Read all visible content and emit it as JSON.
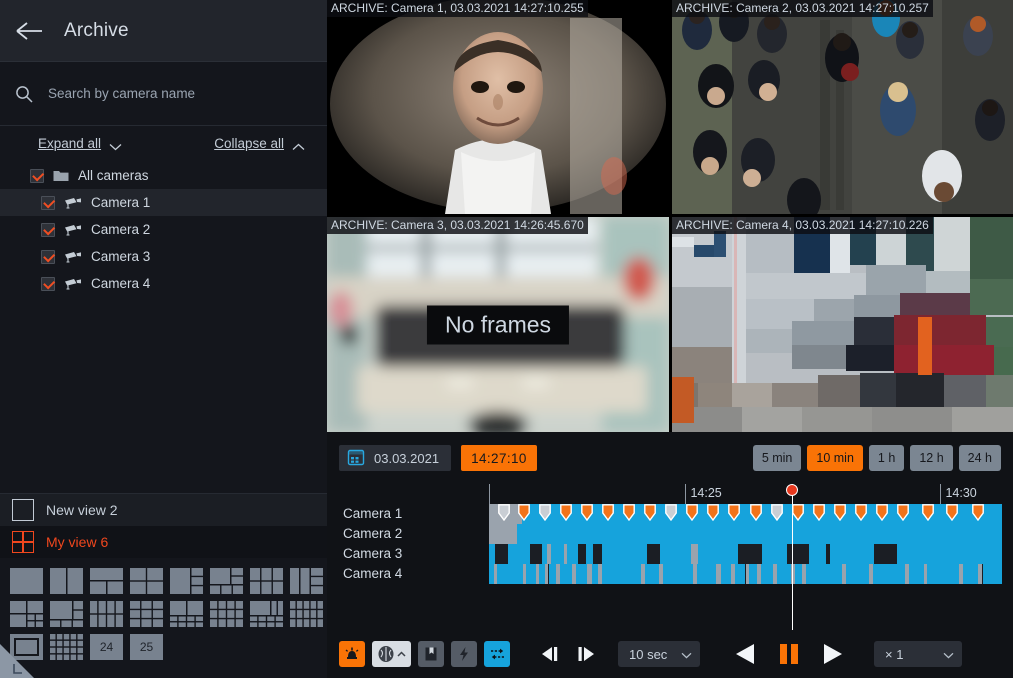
{
  "sidebar": {
    "back_icon": "back-arrow-icon",
    "title": "Archive",
    "search": {
      "icon": "search-icon",
      "placeholder": "Search by camera name",
      "value": ""
    },
    "expand_all": "Expand all",
    "collapse_all": "Collapse all",
    "tree": [
      {
        "label": "All cameras",
        "icon": "folder-icon",
        "checked": true,
        "selected": false,
        "level": 0
      },
      {
        "label": "Camera 1",
        "icon": "camera-icon",
        "checked": true,
        "selected": true,
        "level": 1
      },
      {
        "label": "Camera 2",
        "icon": "camera-icon",
        "checked": true,
        "selected": false,
        "level": 1
      },
      {
        "label": "Camera 3",
        "icon": "camera-icon",
        "checked": true,
        "selected": false,
        "level": 1
      },
      {
        "label": "Camera 4",
        "icon": "camera-icon",
        "checked": true,
        "selected": false,
        "level": 1
      }
    ],
    "views": [
      {
        "label": "New view 2",
        "icon": "empty-view-icon",
        "active": false
      },
      {
        "label": "My view 6",
        "icon": "grid-2x2-icon",
        "active": true
      }
    ],
    "layout_numeric": [
      "24",
      "25"
    ]
  },
  "video": {
    "panels": [
      {
        "caption": "ARCHIVE: Camera 1, 03.03.2021 14:27:10.255",
        "no_frames": false,
        "scene": "portrait-man-hoodie"
      },
      {
        "caption": "ARCHIVE: Camera 2, 03.03.2021 14:27:10.257",
        "no_frames": false,
        "scene": "aerial-crowd-pavement"
      },
      {
        "caption": "ARCHIVE: Camera 3, 03.03.2021 14:26:45.670",
        "no_frames": true,
        "scene": "blurred-interior-room"
      },
      {
        "caption": "ARCHIVE: Camera 4, 03.03.2021 14:27:10.226",
        "no_frames": false,
        "scene": "pixelated-street-car"
      }
    ],
    "no_frames_label": "No frames"
  },
  "timeline": {
    "calendar_icon": "calendar-icon",
    "date": "03.03.2021",
    "time": "14:27:10",
    "durations": [
      {
        "label": "5 min",
        "active": false
      },
      {
        "label": "10 min",
        "active": true
      },
      {
        "label": "1 h",
        "active": false
      },
      {
        "label": "12 h",
        "active": false
      },
      {
        "label": "24 h",
        "active": false
      }
    ],
    "ruler_labels": [
      {
        "text": "",
        "pct": 0
      },
      {
        "text": "14:25",
        "pct": 38.3
      },
      {
        "text": "14:30",
        "pct": 88.0
      }
    ],
    "playhead_pct": 59.0,
    "tracks": [
      {
        "label": "Camera 1",
        "segments": [
          {
            "start": 0,
            "end": 6.4,
            "color": "#9aa3ad"
          },
          {
            "start": 6.4,
            "end": 100,
            "color": "#16a3dc"
          }
        ],
        "markers_pct": [
          2.9,
          6.9,
          11.0,
          15.1,
          19.2,
          23.2,
          27.3,
          31.4,
          35.5,
          39.5,
          43.6,
          47.7,
          52.0,
          56.1,
          60.3,
          64.4,
          68.4,
          72.5,
          76.6,
          80.7,
          85.5,
          90.2,
          95.3
        ],
        "markers_gray_idx": [
          0,
          2,
          8,
          13
        ]
      },
      {
        "label": "Camera 2",
        "segments": [
          {
            "start": 0,
            "end": 5.4,
            "color": "#9aa3ad"
          },
          {
            "start": 5.4,
            "end": 100,
            "color": "#16a3dc"
          }
        ],
        "markers_pct": [],
        "markers_gray_idx": []
      },
      {
        "label": "Camera 3",
        "segments": [
          {
            "start": 0.0,
            "end": 1.1,
            "color": "#16a3dc"
          },
          {
            "start": 1.1,
            "end": 3.8,
            "color": "#1b1e24"
          },
          {
            "start": 3.8,
            "end": 8.0,
            "color": "#16a3dc"
          },
          {
            "start": 8.0,
            "end": 10.3,
            "color": "#1b1e24"
          },
          {
            "start": 10.3,
            "end": 11.4,
            "color": "#16a3dc"
          },
          {
            "start": 11.4,
            "end": 12.0,
            "color": "#9aa3ad"
          },
          {
            "start": 12.0,
            "end": 14.6,
            "color": "#16a3dc"
          },
          {
            "start": 14.6,
            "end": 15.2,
            "color": "#9aa3ad"
          },
          {
            "start": 15.2,
            "end": 17.4,
            "color": "#16a3dc"
          },
          {
            "start": 17.4,
            "end": 19.0,
            "color": "#1b1e24"
          },
          {
            "start": 19.0,
            "end": 20.3,
            "color": "#16a3dc"
          },
          {
            "start": 20.3,
            "end": 22.0,
            "color": "#1b1e24"
          },
          {
            "start": 22.0,
            "end": 30.8,
            "color": "#16a3dc"
          },
          {
            "start": 30.8,
            "end": 33.4,
            "color": "#1b1e24"
          },
          {
            "start": 33.4,
            "end": 39.4,
            "color": "#16a3dc"
          },
          {
            "start": 39.4,
            "end": 40.8,
            "color": "#9aa3ad"
          },
          {
            "start": 40.8,
            "end": 48.6,
            "color": "#16a3dc"
          },
          {
            "start": 48.6,
            "end": 53.3,
            "color": "#1b1e24"
          },
          {
            "start": 53.3,
            "end": 58.0,
            "color": "#16a3dc"
          },
          {
            "start": 58.0,
            "end": 62.3,
            "color": "#1b1e24"
          },
          {
            "start": 62.3,
            "end": 65.6,
            "color": "#16a3dc"
          },
          {
            "start": 65.6,
            "end": 66.5,
            "color": "#1b1e24"
          },
          {
            "start": 66.5,
            "end": 75.0,
            "color": "#16a3dc"
          },
          {
            "start": 75.0,
            "end": 79.6,
            "color": "#1b1e24"
          },
          {
            "start": 79.6,
            "end": 100,
            "color": "#16a3dc"
          }
        ],
        "markers_pct": [],
        "markers_gray_idx": []
      },
      {
        "label": "Camera 4",
        "segments": [
          {
            "start": 0.0,
            "end": 0.9,
            "color": "#16a3dc"
          },
          {
            "start": 0.9,
            "end": 1.5,
            "color": "#9aa3ad"
          },
          {
            "start": 1.5,
            "end": 6.6,
            "color": "#16a3dc"
          },
          {
            "start": 6.6,
            "end": 7.3,
            "color": "#9aa3ad"
          },
          {
            "start": 7.3,
            "end": 9.1,
            "color": "#16a3dc"
          },
          {
            "start": 9.1,
            "end": 9.8,
            "color": "#9aa3ad"
          },
          {
            "start": 9.8,
            "end": 11.0,
            "color": "#16a3dc"
          },
          {
            "start": 11.0,
            "end": 11.6,
            "color": "#9aa3ad"
          },
          {
            "start": 11.6,
            "end": 13.1,
            "color": "#16a3dc"
          },
          {
            "start": 13.1,
            "end": 13.8,
            "color": "#9aa3ad"
          },
          {
            "start": 13.8,
            "end": 16.2,
            "color": "#16a3dc"
          },
          {
            "start": 16.2,
            "end": 16.9,
            "color": "#9aa3ad"
          },
          {
            "start": 16.9,
            "end": 19.2,
            "color": "#16a3dc"
          },
          {
            "start": 19.2,
            "end": 20.0,
            "color": "#9aa3ad"
          },
          {
            "start": 20.0,
            "end": 21.3,
            "color": "#16a3dc"
          },
          {
            "start": 21.3,
            "end": 22.0,
            "color": "#9aa3ad"
          },
          {
            "start": 22.0,
            "end": 29.6,
            "color": "#16a3dc"
          },
          {
            "start": 29.6,
            "end": 30.4,
            "color": "#9aa3ad"
          },
          {
            "start": 30.4,
            "end": 33.2,
            "color": "#16a3dc"
          },
          {
            "start": 33.2,
            "end": 34.0,
            "color": "#9aa3ad"
          },
          {
            "start": 34.0,
            "end": 39.8,
            "color": "#16a3dc"
          },
          {
            "start": 39.8,
            "end": 40.6,
            "color": "#9aa3ad"
          },
          {
            "start": 40.6,
            "end": 44.2,
            "color": "#16a3dc"
          },
          {
            "start": 44.2,
            "end": 45.2,
            "color": "#9aa3ad"
          },
          {
            "start": 45.2,
            "end": 47.2,
            "color": "#16a3dc"
          },
          {
            "start": 47.2,
            "end": 48.0,
            "color": "#9aa3ad"
          },
          {
            "start": 48.0,
            "end": 50.0,
            "color": "#16a3dc"
          },
          {
            "start": 50.0,
            "end": 50.7,
            "color": "#9aa3ad"
          },
          {
            "start": 50.7,
            "end": 52.3,
            "color": "#16a3dc"
          },
          {
            "start": 52.3,
            "end": 53.0,
            "color": "#9aa3ad"
          },
          {
            "start": 53.0,
            "end": 55.4,
            "color": "#16a3dc"
          },
          {
            "start": 55.4,
            "end": 56.1,
            "color": "#9aa3ad"
          },
          {
            "start": 56.1,
            "end": 58.9,
            "color": "#16a3dc"
          },
          {
            "start": 58.9,
            "end": 59.6,
            "color": "#9aa3ad"
          },
          {
            "start": 59.6,
            "end": 61.0,
            "color": "#16a3dc"
          },
          {
            "start": 61.0,
            "end": 61.7,
            "color": "#9aa3ad"
          },
          {
            "start": 61.7,
            "end": 68.8,
            "color": "#16a3dc"
          },
          {
            "start": 68.8,
            "end": 69.6,
            "color": "#9aa3ad"
          },
          {
            "start": 69.6,
            "end": 74.0,
            "color": "#16a3dc"
          },
          {
            "start": 74.0,
            "end": 74.8,
            "color": "#9aa3ad"
          },
          {
            "start": 74.8,
            "end": 81.0,
            "color": "#16a3dc"
          },
          {
            "start": 81.0,
            "end": 81.8,
            "color": "#9aa3ad"
          },
          {
            "start": 81.8,
            "end": 84.7,
            "color": "#16a3dc"
          },
          {
            "start": 84.7,
            "end": 85.4,
            "color": "#9aa3ad"
          },
          {
            "start": 85.4,
            "end": 91.6,
            "color": "#16a3dc"
          },
          {
            "start": 91.6,
            "end": 92.4,
            "color": "#9aa3ad"
          },
          {
            "start": 92.4,
            "end": 95.4,
            "color": "#16a3dc"
          },
          {
            "start": 95.4,
            "end": 96.2,
            "color": "#9aa3ad"
          },
          {
            "start": 96.2,
            "end": 100,
            "color": "#16a3dc"
          }
        ],
        "markers_pct": [],
        "markers_gray_idx": []
      }
    ]
  },
  "playback": {
    "tools": [
      {
        "name": "alarm-icon",
        "style": "orange"
      },
      {
        "name": "brain-icon",
        "style": "light",
        "has_chevron": true
      },
      {
        "name": "bookmark-icon",
        "style": "dark"
      },
      {
        "name": "lightning-icon",
        "style": "dark"
      },
      {
        "name": "sync-icon",
        "style": "blue"
      }
    ],
    "step_back_icon": "step-back-icon",
    "step_fwd_icon": "step-forward-icon",
    "step_value": "10 sec",
    "rewind_icon": "rewind-icon",
    "pause_icon": "pause-icon",
    "play_icon": "play-icon",
    "speed_value": "× 1"
  },
  "colors": {
    "accent_orange": "#f97306",
    "accent_red": "#f0471e",
    "track_blue": "#16a3dc",
    "track_gray": "#9aa3ad",
    "panel_bg": "#14161c"
  }
}
